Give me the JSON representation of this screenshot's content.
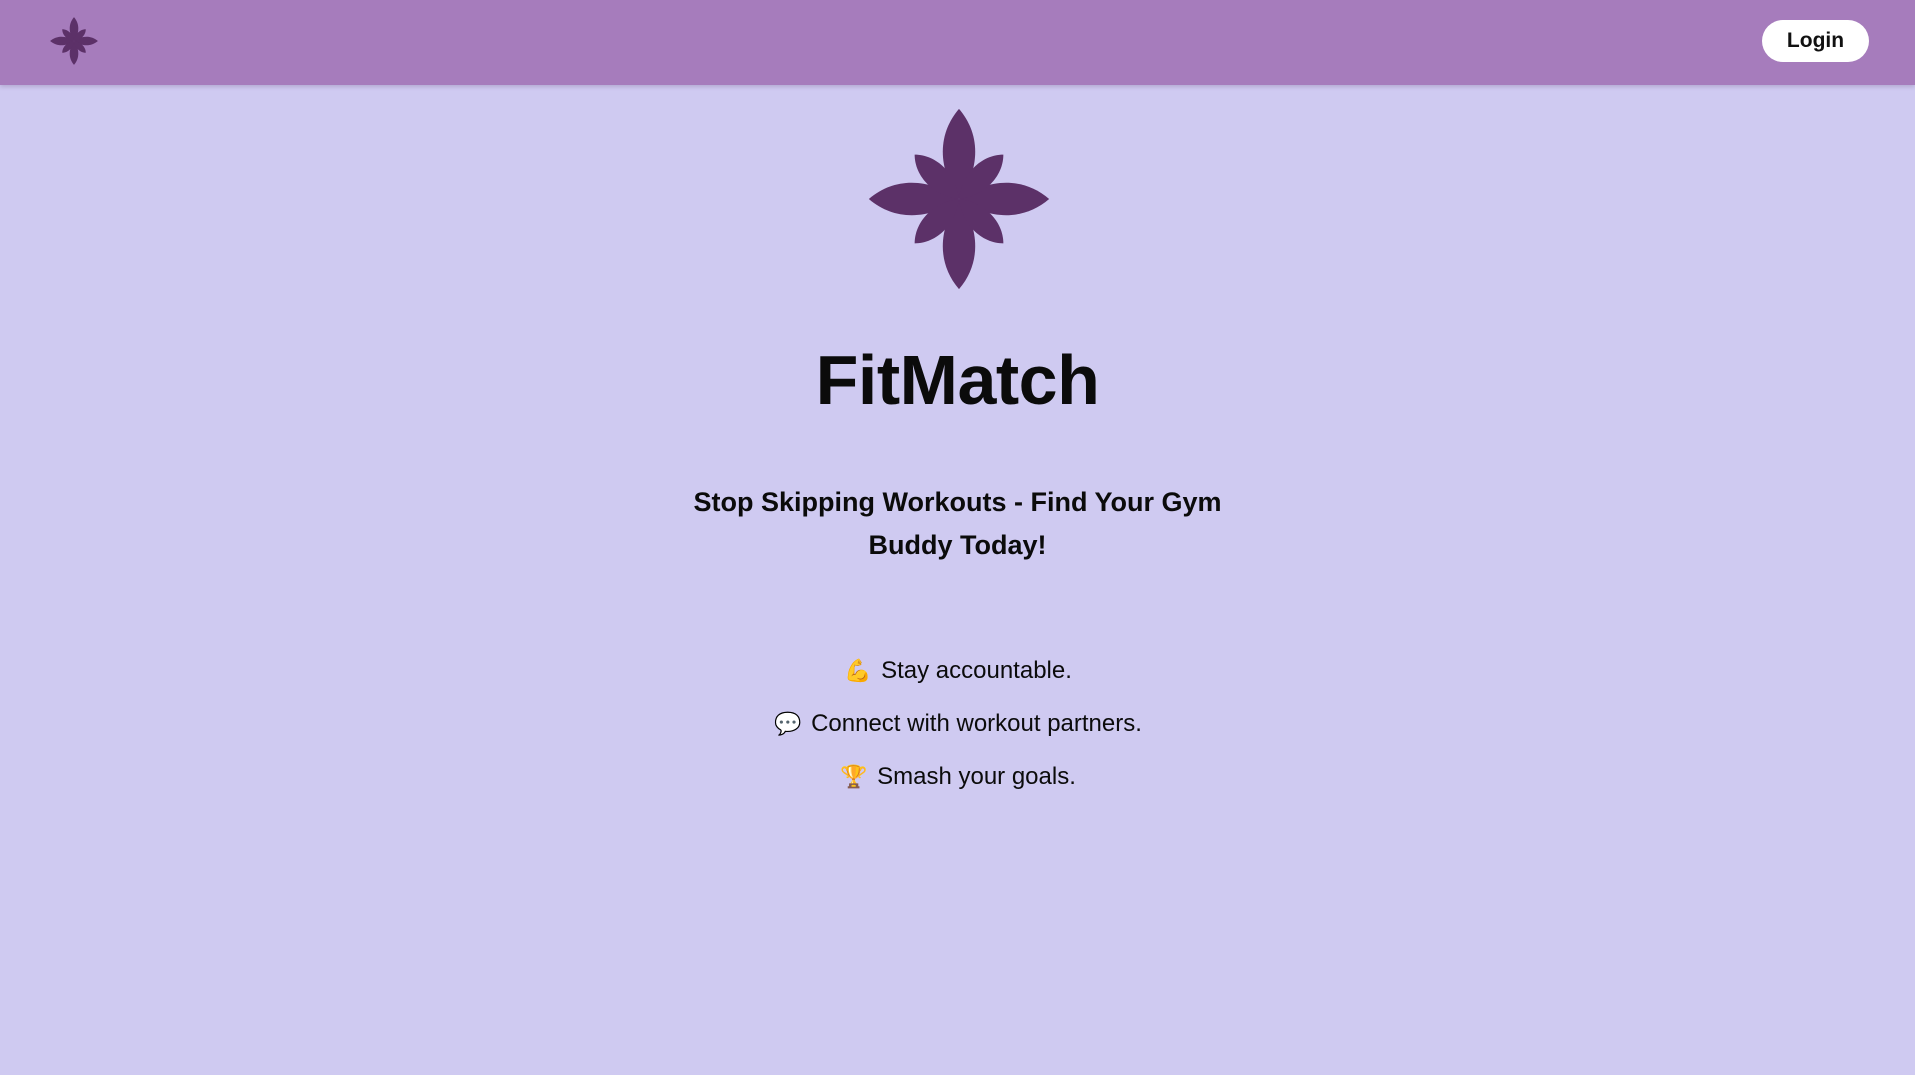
{
  "header": {
    "logo_icon": "flower-logo-icon",
    "login_label": "Login"
  },
  "hero": {
    "logo_icon": "flower-logo-icon",
    "title": "FitMatch",
    "tagline": "Stop Skipping Workouts - Find Your Gym Buddy Today!"
  },
  "features": [
    {
      "icon": "💪",
      "icon_name": "flexed-biceps-icon",
      "text": "Stay accountable."
    },
    {
      "icon": "💬",
      "icon_name": "speech-bubble-icon",
      "text": "Connect with workout partners."
    },
    {
      "icon": "🏆",
      "icon_name": "trophy-icon",
      "text": "Smash your goals."
    }
  ],
  "colors": {
    "background": "#cfcaf1",
    "navbar": "#a67cbc",
    "logo": "#5c3168",
    "button_bg": "#ffffff",
    "text": "#0b0b0b"
  }
}
